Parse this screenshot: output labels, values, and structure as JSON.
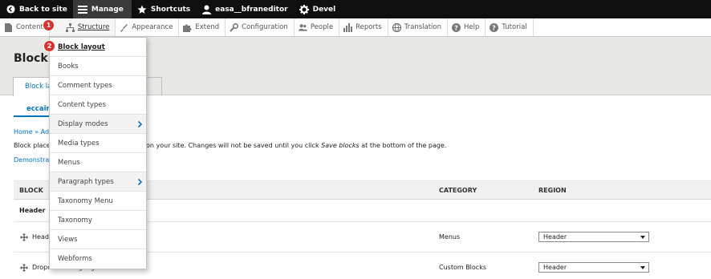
{
  "toolbar": {
    "back": "Back to site",
    "manage": "Manage",
    "shortcuts": "Shortcuts",
    "user": "easa__bfraneditor",
    "devel": "Devel"
  },
  "menu": {
    "items": [
      {
        "label": "Content",
        "icon": "file-icon"
      },
      {
        "label": "Structure",
        "icon": "structure-icon"
      },
      {
        "label": "Appearance",
        "icon": "brush-icon"
      },
      {
        "label": "Extend",
        "icon": "puzzle-icon"
      },
      {
        "label": "Configuration",
        "icon": "wrench-icon"
      },
      {
        "label": "People",
        "icon": "people-icon"
      },
      {
        "label": "Reports",
        "icon": "bar-chart-icon"
      },
      {
        "label": "Translation",
        "icon": "globe-icon"
      },
      {
        "label": "Help",
        "icon": "help-icon"
      },
      {
        "label": "Tutorial",
        "icon": "help-icon"
      }
    ]
  },
  "page": {
    "title": "Block la",
    "tab_primary": "Block lay",
    "tab_secondary": "y",
    "subtab": "eccairs",
    "breadcrumb": "Home » Adr",
    "description_left": "Block placem",
    "description_right_pre": "on your site. Changes will not be saved until you click ",
    "description_right_em": "Save blocks",
    "description_right_post": " at the bottom of the page.",
    "demo_link": "Demonstrat"
  },
  "table": {
    "col_block": "BLOCK",
    "col_category": "CATEGORY",
    "col_region": "REGION",
    "section_header": "Header",
    "rows": [
      {
        "block": "Heade",
        "category": "Menus",
        "region": "Header"
      },
      {
        "block": "Dropdown Language",
        "category": "Custom Blocks",
        "region": "Header"
      }
    ]
  },
  "dropdown": {
    "items": [
      {
        "label": "Block layout",
        "submenu": false
      },
      {
        "label": "Books",
        "submenu": false
      },
      {
        "label": "Comment types",
        "submenu": false
      },
      {
        "label": "Content types",
        "submenu": false
      },
      {
        "label": "Display modes",
        "submenu": true
      },
      {
        "label": "Media types",
        "submenu": false
      },
      {
        "label": "Menus",
        "submenu": false
      },
      {
        "label": "Paragraph types",
        "submenu": true
      },
      {
        "label": "Taxonomy Menu",
        "submenu": false
      },
      {
        "label": "Taxonomy",
        "submenu": false
      },
      {
        "label": "Views",
        "submenu": false
      },
      {
        "label": "Webforms",
        "submenu": false
      }
    ]
  },
  "badges": {
    "one": "1",
    "two": "2"
  },
  "colors": {
    "link": "#0074bd",
    "toolbar": "#0f0f0f",
    "badge": "#d9322e"
  }
}
